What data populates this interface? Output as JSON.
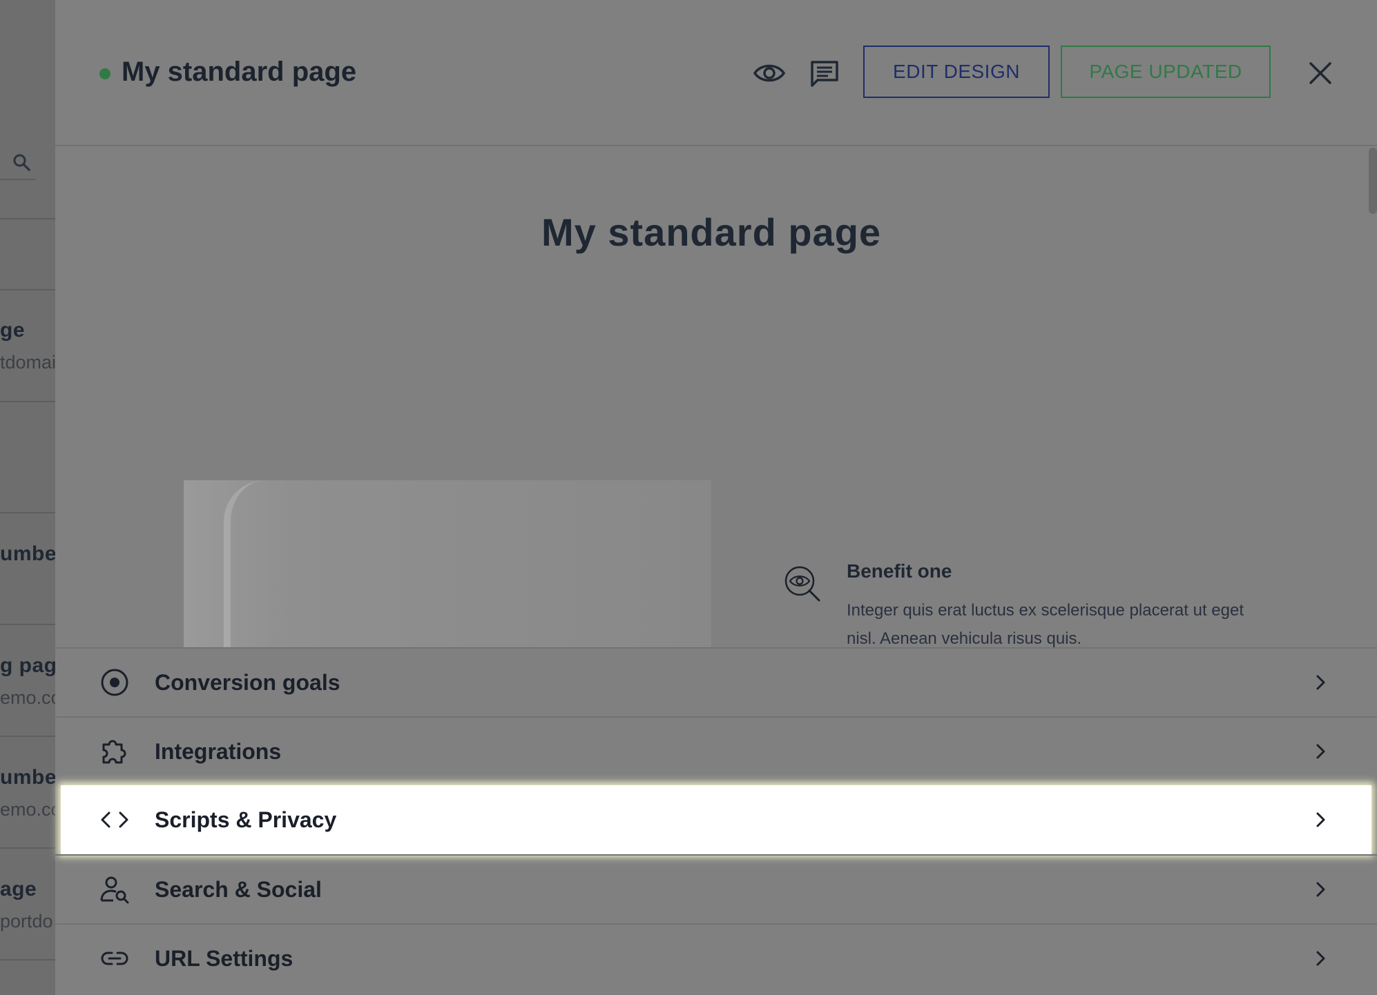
{
  "background_list": {
    "items": [
      {
        "title": "ge",
        "subtitle": "tdomai"
      },
      {
        "title": "umbe",
        "subtitle": ""
      },
      {
        "title": "g page",
        "subtitle": "emo.co"
      },
      {
        "title": "umbe",
        "subtitle": "emo.co"
      },
      {
        "title": "age",
        "subtitle": "portdo"
      }
    ]
  },
  "header": {
    "title": "My standard page",
    "status_color": "#2f7a45",
    "preview_icon": "eye-icon",
    "comments_icon": "comment-icon",
    "edit_design_label": "EDIT DESIGN",
    "page_updated_label": "PAGE UPDATED",
    "close_icon": "close-icon"
  },
  "preview": {
    "heading": "My standard page",
    "benefit": {
      "icon": "eye-search-icon",
      "title": "Benefit one",
      "text": "Integer quis erat luctus ex scelerisque placerat ut eget nisl. Aenean vehicula risus quis."
    }
  },
  "settings": {
    "items": [
      {
        "label": "Conversion goals",
        "icon": "target-icon",
        "highlighted": false
      },
      {
        "label": "Integrations",
        "icon": "puzzle-icon",
        "highlighted": false
      },
      {
        "label": "Scripts & Privacy",
        "icon": "code-icon",
        "highlighted": true
      },
      {
        "label": "Search & Social",
        "icon": "user-search-icon",
        "highlighted": false
      },
      {
        "label": "URL Settings",
        "icon": "link-icon",
        "highlighted": false
      }
    ]
  },
  "colors": {
    "overlay": "#808080",
    "brand_blue": "#1f2d6a",
    "success_green": "#2f7a45",
    "highlight": "#ffffff"
  }
}
